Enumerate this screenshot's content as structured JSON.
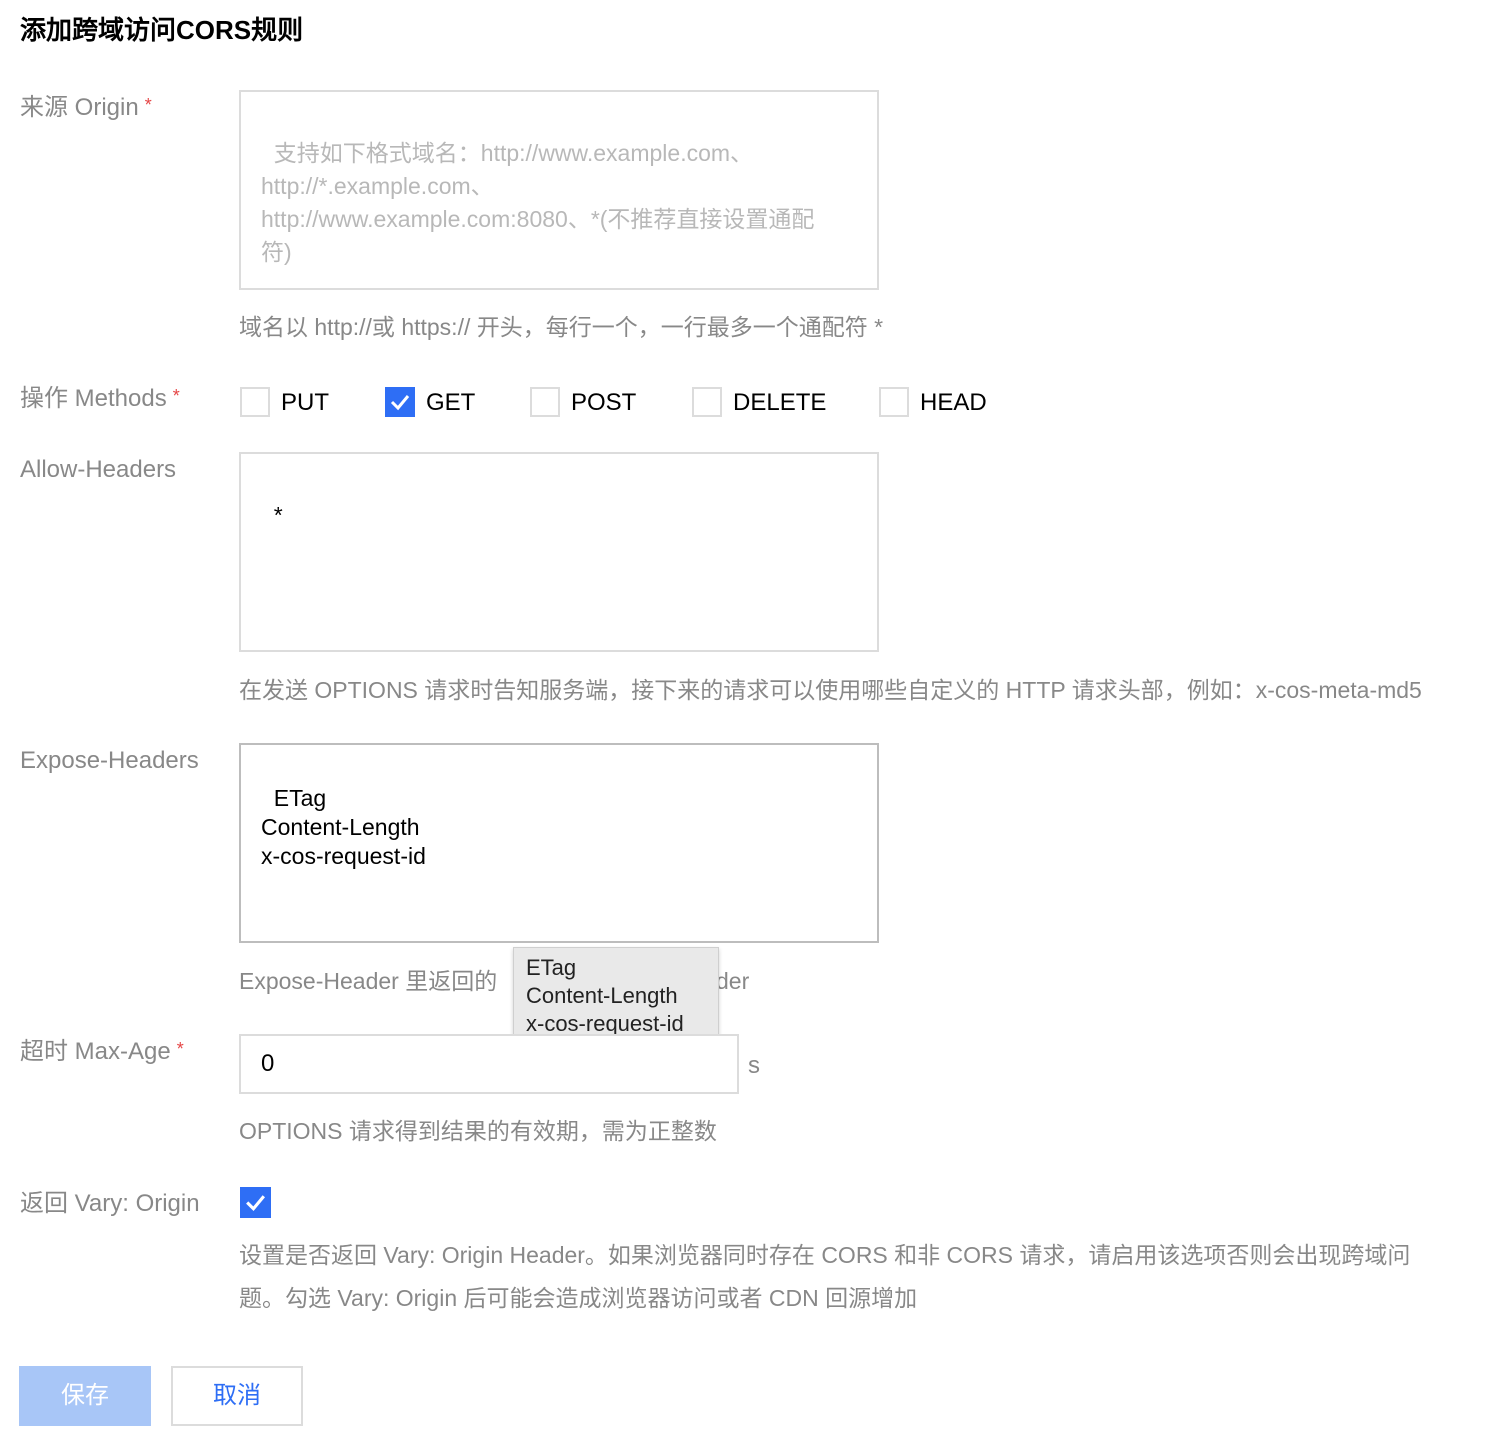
{
  "title": "添加跨域访问CORS规则",
  "origin": {
    "label": "来源 Origin",
    "required_mark": "*",
    "placeholder": "支持如下格式域名：http://www.example.com、\nhttp://*.example.com、\nhttp://www.example.com:8080、*(不推荐直接设置通配\n符)",
    "help": "域名以 http://或 https:// 开头，每行一个，一行最多一个通配符 *"
  },
  "methods": {
    "label": "操作 Methods",
    "required_mark": "*",
    "options": [
      {
        "label": "PUT",
        "checked": false
      },
      {
        "label": "GET",
        "checked": true
      },
      {
        "label": "POST",
        "checked": false
      },
      {
        "label": "DELETE",
        "checked": false
      },
      {
        "label": "HEAD",
        "checked": false
      }
    ]
  },
  "allow_headers": {
    "label": "Allow-Headers",
    "value": "*",
    "help": "在发送 OPTIONS 请求时告知服务端，接下来的请求可以使用哪些自定义的 HTTP 请求头部，例如：x-cos-meta-md5"
  },
  "expose_headers": {
    "label": "Expose-Headers",
    "value": "ETag\nContent-Length\nx-cos-request-id",
    "help_left": "Expose-Header 里返回的",
    "help_right": "der",
    "tooltip": "ETag\nContent-Length\nx-cos-request-id"
  },
  "max_age": {
    "label": "超时 Max-Age",
    "required_mark": "*",
    "value": "0",
    "unit": "s",
    "help": "OPTIONS 请求得到结果的有效期，需为正整数"
  },
  "vary": {
    "label": "返回 Vary: Origin",
    "checked": true,
    "help_line1": "设置是否返回 Vary: Origin Header。如果浏览器同时存在 CORS 和非 CORS 请求，请启用该选项否则会出现跨域问",
    "help_line2": "题。勾选 Vary: Origin 后可能会造成浏览器访问或者 CDN 回源增加"
  },
  "buttons": {
    "save": "保存",
    "cancel": "取消"
  },
  "colors": {
    "primary": "#2e6ef5",
    "primary_disabled": "#a8c6f7",
    "required": "#e54545",
    "muted_text": "#888888"
  }
}
